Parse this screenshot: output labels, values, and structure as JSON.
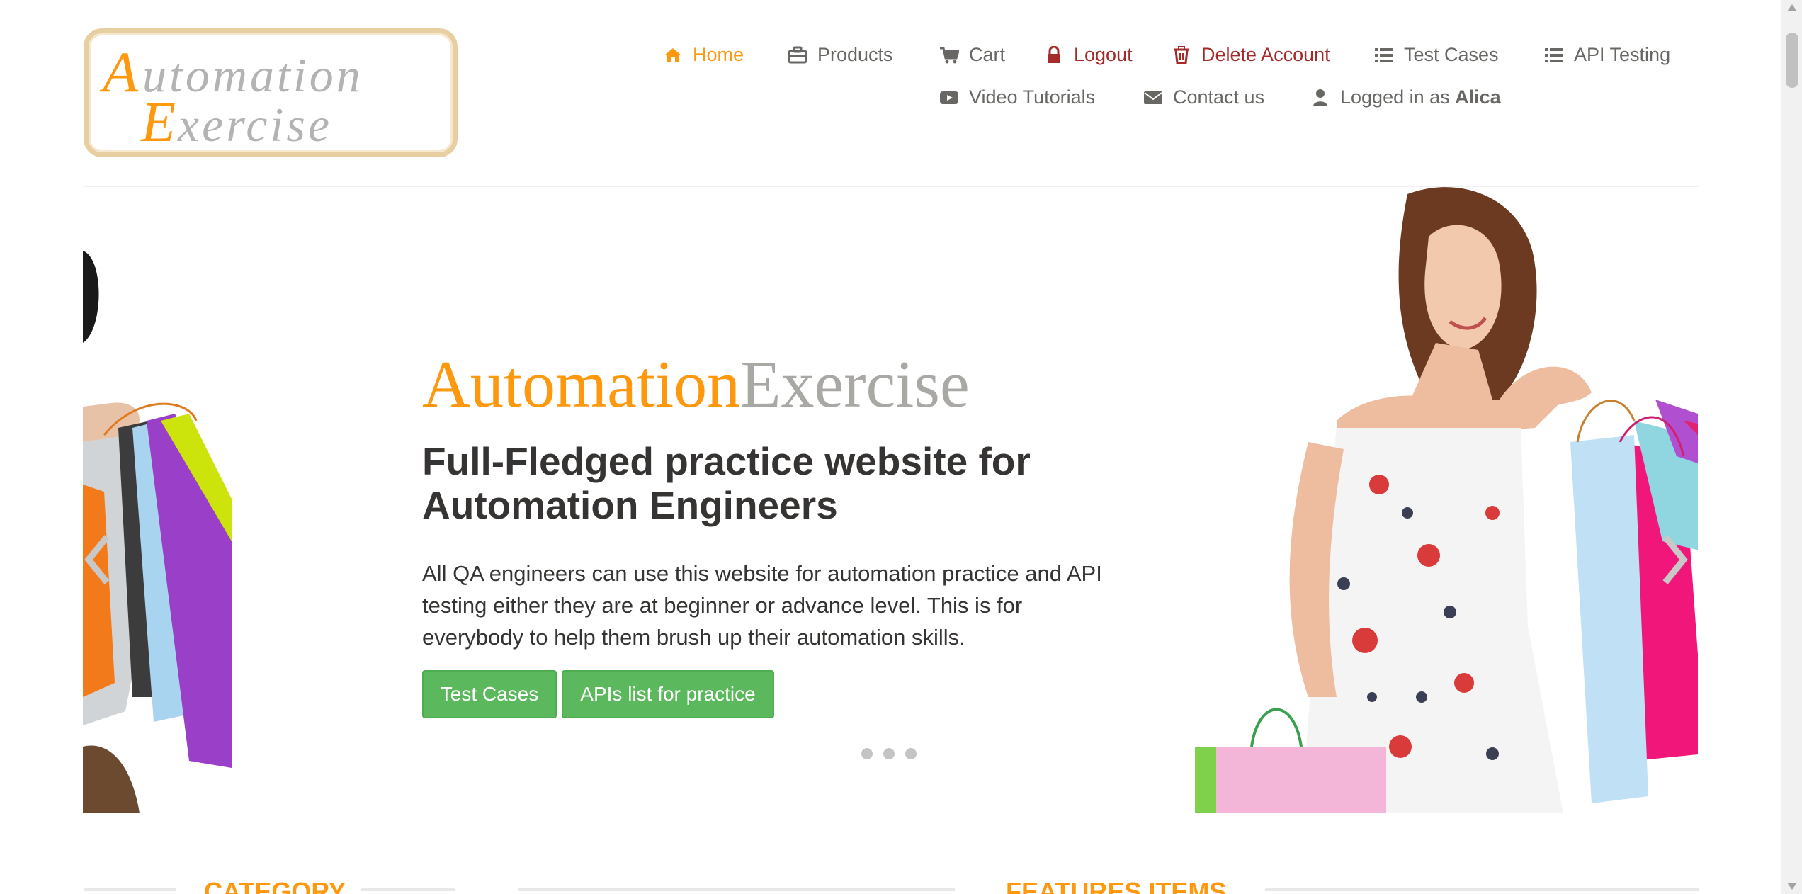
{
  "logo": {
    "line1": "Automation",
    "line2": "Exercise",
    "colors": {
      "orange": "#fe980f",
      "gray": "#a5a5a5",
      "border": "#e8cfa2"
    }
  },
  "nav": {
    "items": [
      {
        "label": "Home",
        "icon": "home-icon"
      },
      {
        "label": "Products",
        "icon": "briefcase-icon"
      },
      {
        "label": "Cart",
        "icon": "shopping-cart-icon"
      },
      {
        "label": "Logout",
        "icon": "lock-icon"
      },
      {
        "label": "Delete Account",
        "icon": "trash-icon"
      },
      {
        "label": "Test Cases",
        "icon": "list-icon"
      },
      {
        "label": "API Testing",
        "icon": "list-icon"
      },
      {
        "label": "Video Tutorials",
        "icon": "youtube-play-icon"
      },
      {
        "label": "Contact us",
        "icon": "envelope-icon"
      }
    ],
    "logged_in_prefix": "Logged in as",
    "logged_in_user": "Alica",
    "logged_in_icon": "user-icon",
    "colors": {
      "active": "#fe980f",
      "danger": "#a52a2a",
      "default": "#696763"
    }
  },
  "slider": {
    "brand_part1": "Automation",
    "brand_part2": "Exercise",
    "headline": "Full-Fledged practice website for Automation Engineers",
    "description": "All QA engineers can use this website for automation practice and API testing either they are at beginner or advance level. This is for everybody to help them brush up their automation skills.",
    "btn_test_cases": "Test Cases",
    "btn_apis": "APIs list for practice",
    "dots_count": 3,
    "prev_icon": "chevron-left-icon",
    "next_icon": "chevron-right-icon",
    "button_color": "#5cb85c"
  },
  "sections": {
    "category": "CATEGORY",
    "features": "FEATURES ITEMS"
  }
}
